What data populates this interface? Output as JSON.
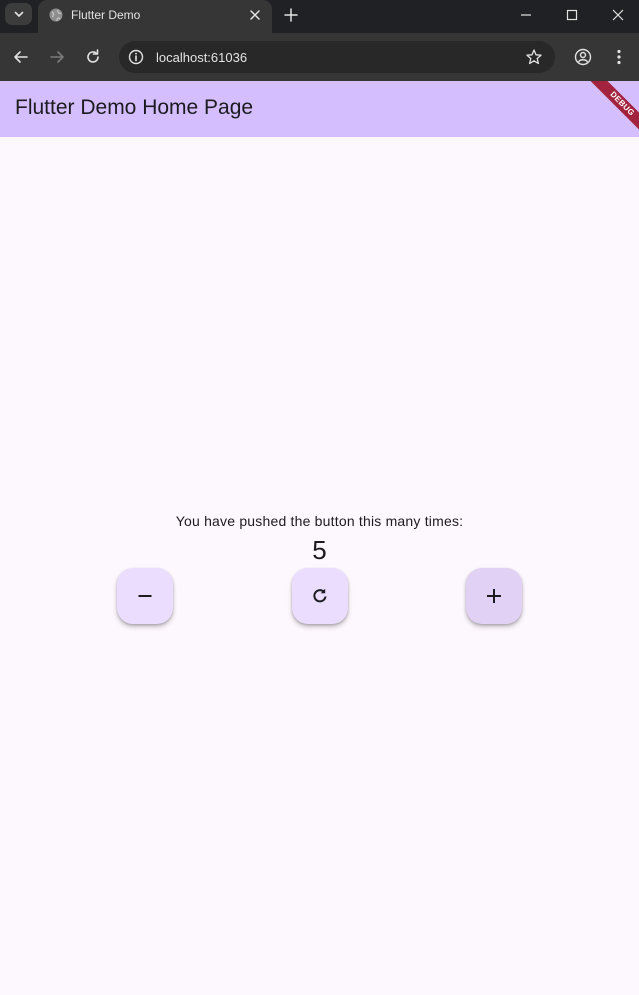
{
  "browser": {
    "tab_title": "Flutter Demo",
    "url": "localhost:61036"
  },
  "app": {
    "title": "Flutter Demo Home Page",
    "debug_banner": "DEBUG",
    "counter_label": "You have pushed the button this many times:",
    "counter_value": "5"
  },
  "icons": {
    "tab_search": "chevron-down-icon",
    "favicon": "globe-icon",
    "tab_close": "close-icon",
    "new_tab": "plus-icon",
    "minimize": "minimize-icon",
    "maximize": "maximize-icon",
    "close": "close-icon",
    "back": "arrow-left-icon",
    "forward": "arrow-right-icon",
    "reload": "reload-icon",
    "site_info": "info-icon",
    "bookmark": "star-icon",
    "profile": "profile-icon",
    "menu": "more-vert-icon",
    "decrement": "minus-icon",
    "reset": "refresh-icon",
    "increment": "plus-icon"
  },
  "colors": {
    "appbar": "#d4befe",
    "background": "#fdf7fe",
    "fab": "#ebddfe",
    "debug_banner": "#a3223d",
    "browser_chrome": "#202124"
  }
}
